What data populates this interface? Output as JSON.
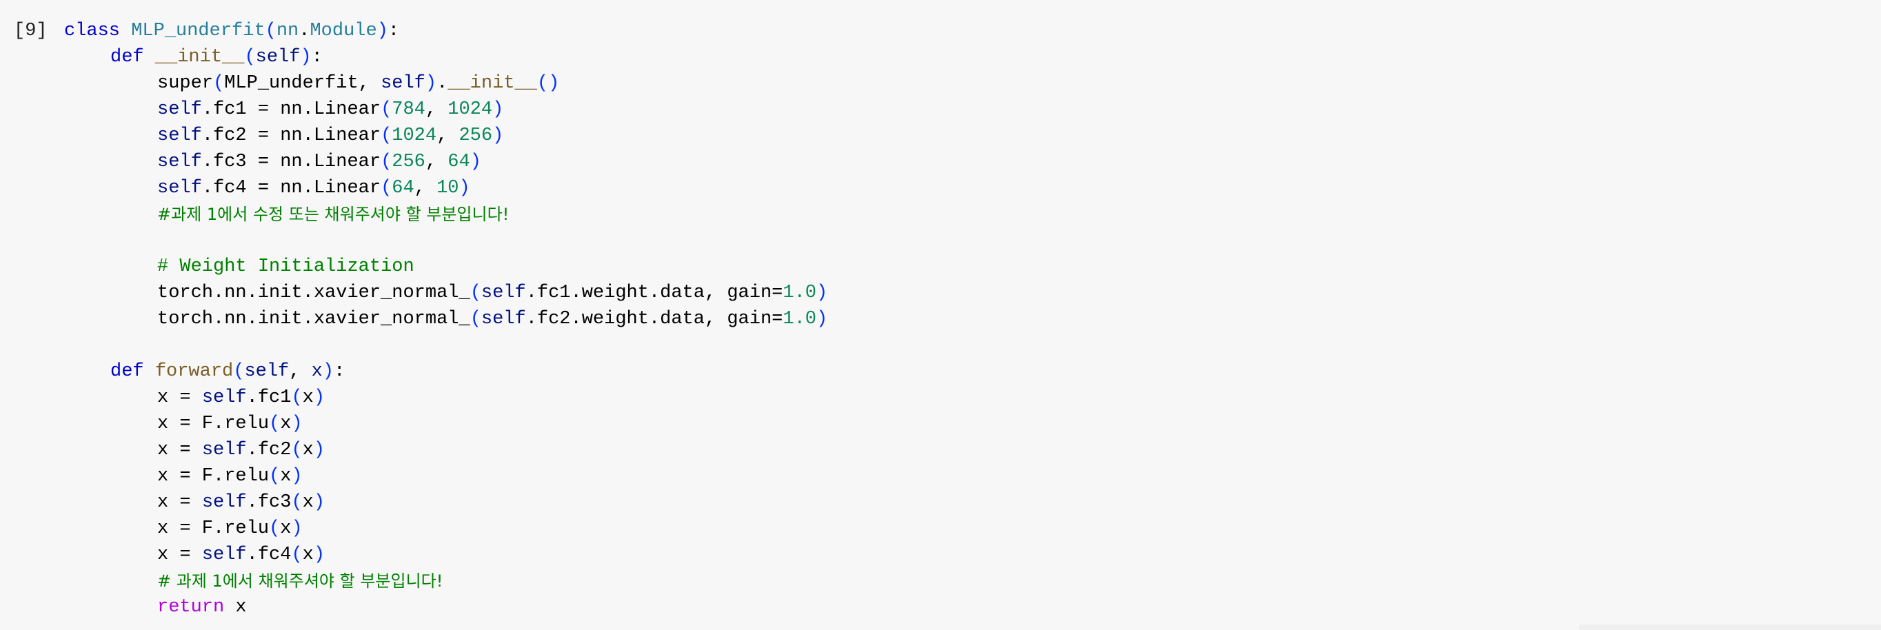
{
  "cell": {
    "prompt": "[9]"
  },
  "code": {
    "l1": {
      "kw": "class",
      "name": "MLP_underfit",
      "p1": "(",
      "base_mod": "nn",
      "dot": ".",
      "base": "Module",
      "p2": ")",
      "colon": ":"
    },
    "l2": {
      "kw": "def",
      "name": "__init__",
      "p1": "(",
      "self": "self",
      "p2": ")",
      "colon": ":"
    },
    "l3": {
      "a": "super",
      "p1": "(",
      "b": "MLP_underfit, ",
      "self": "self",
      "p2": ")",
      "c": ".",
      "init": "__init__",
      "p3": "()"
    },
    "l4": {
      "self": "self",
      "a": ".fc1 = nn.Linear",
      "p1": "(",
      "n1": "784",
      "sep": ", ",
      "n2": "1024",
      "p2": ")"
    },
    "l5": {
      "self": "self",
      "a": ".fc2 = nn.Linear",
      "p1": "(",
      "n1": "1024",
      "sep": ", ",
      "n2": "256",
      "p2": ")"
    },
    "l6": {
      "self": "self",
      "a": ".fc3 = nn.Linear",
      "p1": "(",
      "n1": "256",
      "sep": ", ",
      "n2": "64",
      "p2": ")"
    },
    "l7": {
      "self": "self",
      "a": ".fc4 = nn.Linear",
      "p1": "(",
      "n1": "64",
      "sep": ", ",
      "n2": "10",
      "p2": ")"
    },
    "l8": {
      "comment": "#과제 1에서 수정 또는 채워주셔야 할 부분입니다!"
    },
    "l10": {
      "comment": "# Weight Initialization"
    },
    "l11": {
      "a": "torch.nn.init.xavier_normal_",
      "p1": "(",
      "self": "self",
      "b": ".fc1.weight.data, gain=",
      "n": "1.0",
      "p2": ")"
    },
    "l12": {
      "a": "torch.nn.init.xavier_normal_",
      "p1": "(",
      "self": "self",
      "b": ".fc2.weight.data, gain=",
      "n": "1.0",
      "p2": ")"
    },
    "l14": {
      "kw": "def",
      "name": "forward",
      "p1": "(",
      "self": "self",
      "sep": ", ",
      "x": "x",
      "p2": ")",
      "colon": ":"
    },
    "l15": {
      "a": "x = ",
      "self": "self",
      "b": ".fc1",
      "p1": "(",
      "x": "x",
      "p2": ")"
    },
    "l16": {
      "a": "x = F.relu",
      "p1": "(",
      "x": "x",
      "p2": ")"
    },
    "l17": {
      "a": "x = ",
      "self": "self",
      "b": ".fc2",
      "p1": "(",
      "x": "x",
      "p2": ")"
    },
    "l18": {
      "a": "x = F.relu",
      "p1": "(",
      "x": "x",
      "p2": ")"
    },
    "l19": {
      "a": "x = ",
      "self": "self",
      "b": ".fc3",
      "p1": "(",
      "x": "x",
      "p2": ")"
    },
    "l20": {
      "a": "x = F.relu",
      "p1": "(",
      "x": "x",
      "p2": ")"
    },
    "l21": {
      "a": "x = ",
      "self": "self",
      "b": ".fc4",
      "p1": "(",
      "x": "x",
      "p2": ")"
    },
    "l22": {
      "comment": "# 과제 1에서 채워주셔야 할 부분입니다!"
    },
    "l23": {
      "kw": "return",
      "x": " x"
    }
  },
  "colors": {
    "background": "#f7f7f7",
    "keyword": "#0000cc",
    "class_name": "#267f99",
    "function_name": "#795e26",
    "self": "#001080",
    "number": "#098658",
    "bracket": "#0431fa",
    "comment": "#008000",
    "return_keyword": "#af00db"
  }
}
